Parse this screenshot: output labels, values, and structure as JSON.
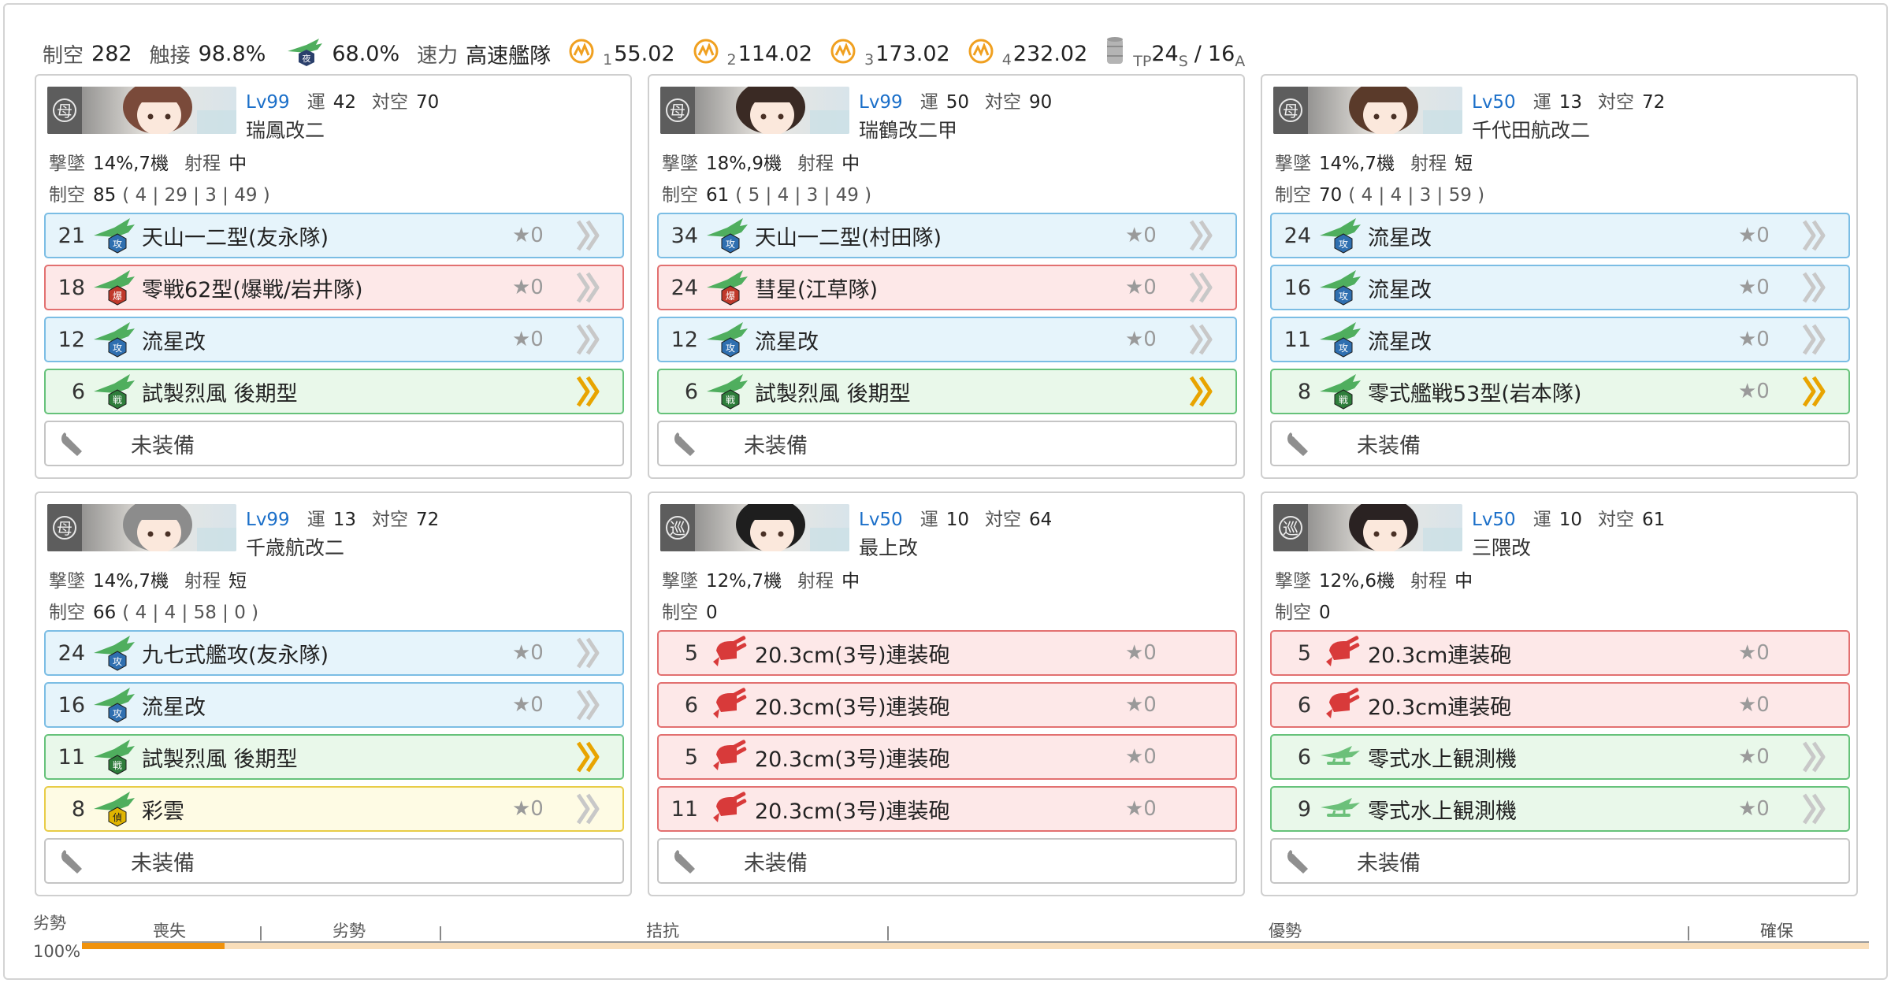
{
  "header": {
    "air_label": "制空",
    "air_value": "282",
    "contact_label": "触接",
    "contact_value": "98.8%",
    "recon_value": "68.0%",
    "speed_label": "速力",
    "speed_value": "高速艦隊",
    "los": [
      {
        "sub": "1",
        "value": "55.02"
      },
      {
        "sub": "2",
        "value": "114.02"
      },
      {
        "sub": "3",
        "value": "173.02"
      },
      {
        "sub": "4",
        "value": "232.02"
      }
    ],
    "tp_sub": "TP",
    "tp_s_value": "24",
    "tp_s_sub": "S",
    "tp_sep": "/",
    "tp_a_value": "16",
    "tp_a_sub": "A"
  },
  "labels": {
    "luck": "運",
    "aa": "対空",
    "shootdown": "撃墜",
    "range": "射程",
    "air": "制空",
    "empty_slot": "未装備"
  },
  "colors": {
    "blue_slot": "#e6f4fb",
    "red_slot": "#fde8e8",
    "green_slot": "#e9f8ea",
    "yellow_slot": "#fefbe4",
    "level_text": "#1b6fc9",
    "bar_fill": "#f0920c"
  },
  "ships": [
    {
      "level": "Lv99",
      "luck": "42",
      "aa": "70",
      "name": "瑞鳳改二",
      "shootdown": "14%,7機",
      "range": "中",
      "air": "85",
      "air_breakdown": "( 4 | 29 | 3 | 49 )",
      "badge": "母",
      "slots": [
        {
          "count": "21",
          "icon": "torpedo-bomber-icon",
          "name": "天山一二型(友永隊)",
          "star": "★0",
          "color": "blue",
          "prof": "gray"
        },
        {
          "count": "18",
          "icon": "dive-bomber-icon",
          "name": "零戦62型(爆戦/岩井隊)",
          "star": "★0",
          "color": "red",
          "prof": "gray"
        },
        {
          "count": "12",
          "icon": "torpedo-bomber-icon",
          "name": "流星改",
          "star": "★0",
          "color": "blue",
          "prof": "gray"
        },
        {
          "count": "6",
          "icon": "fighter-icon",
          "name": "試製烈風 後期型",
          "star": "",
          "color": "green",
          "prof": "gold"
        },
        {
          "count": "",
          "icon": "wrench-icon",
          "name": "未装備",
          "star": "",
          "color": "empty",
          "prof": "none"
        }
      ]
    },
    {
      "level": "Lv99",
      "luck": "50",
      "aa": "90",
      "name": "瑞鶴改二甲",
      "shootdown": "18%,9機",
      "range": "中",
      "air": "61",
      "air_breakdown": "( 5 | 4 | 3 | 49 )",
      "badge": "母",
      "slots": [
        {
          "count": "34",
          "icon": "torpedo-bomber-icon",
          "name": "天山一二型(村田隊)",
          "star": "★0",
          "color": "blue",
          "prof": "gray"
        },
        {
          "count": "24",
          "icon": "dive-bomber-icon",
          "name": "彗星(江草隊)",
          "star": "★0",
          "color": "red",
          "prof": "gray"
        },
        {
          "count": "12",
          "icon": "torpedo-bomber-icon",
          "name": "流星改",
          "star": "★0",
          "color": "blue",
          "prof": "gray"
        },
        {
          "count": "6",
          "icon": "fighter-icon",
          "name": "試製烈風 後期型",
          "star": "",
          "color": "green",
          "prof": "gold"
        },
        {
          "count": "",
          "icon": "wrench-icon",
          "name": "未装備",
          "star": "",
          "color": "empty",
          "prof": "none"
        }
      ]
    },
    {
      "level": "Lv50",
      "luck": "13",
      "aa": "72",
      "name": "千代田航改二",
      "shootdown": "14%,7機",
      "range": "短",
      "air": "70",
      "air_breakdown": "( 4 | 4 | 3 | 59 )",
      "badge": "母",
      "slots": [
        {
          "count": "24",
          "icon": "torpedo-bomber-icon",
          "name": "流星改",
          "star": "★0",
          "color": "blue",
          "prof": "gray"
        },
        {
          "count": "16",
          "icon": "torpedo-bomber-icon",
          "name": "流星改",
          "star": "★0",
          "color": "blue",
          "prof": "gray"
        },
        {
          "count": "11",
          "icon": "torpedo-bomber-icon",
          "name": "流星改",
          "star": "★0",
          "color": "blue",
          "prof": "gray"
        },
        {
          "count": "8",
          "icon": "fighter-icon",
          "name": "零式艦戦53型(岩本隊)",
          "star": "★0",
          "color": "green",
          "prof": "gold"
        },
        {
          "count": "",
          "icon": "wrench-icon",
          "name": "未装備",
          "star": "",
          "color": "empty",
          "prof": "none"
        }
      ]
    },
    {
      "level": "Lv99",
      "luck": "13",
      "aa": "72",
      "name": "千歳航改二",
      "shootdown": "14%,7機",
      "range": "短",
      "air": "66",
      "air_breakdown": "( 4 | 4 | 58 | 0 )",
      "badge": "母",
      "slots": [
        {
          "count": "24",
          "icon": "torpedo-bomber-icon",
          "name": "九七式艦攻(友永隊)",
          "star": "★0",
          "color": "blue",
          "prof": "gray"
        },
        {
          "count": "16",
          "icon": "torpedo-bomber-icon",
          "name": "流星改",
          "star": "★0",
          "color": "blue",
          "prof": "gray"
        },
        {
          "count": "11",
          "icon": "fighter-icon",
          "name": "試製烈風 後期型",
          "star": "",
          "color": "green",
          "prof": "gold"
        },
        {
          "count": "8",
          "icon": "recon-plane-icon",
          "name": "彩雲",
          "star": "★0",
          "color": "yellow",
          "prof": "gray"
        },
        {
          "count": "",
          "icon": "wrench-icon",
          "name": "未装備",
          "star": "",
          "color": "empty",
          "prof": "none"
        }
      ]
    },
    {
      "level": "Lv50",
      "luck": "10",
      "aa": "64",
      "name": "最上改",
      "shootdown": "12%,7機",
      "range": "中",
      "air": "0",
      "air_breakdown": "",
      "badge": "巡",
      "slots": [
        {
          "count": "5",
          "icon": "main-gun-icon",
          "name": "20.3cm(3号)連装砲",
          "star": "★0",
          "color": "red",
          "prof": "none"
        },
        {
          "count": "6",
          "icon": "main-gun-icon",
          "name": "20.3cm(3号)連装砲",
          "star": "★0",
          "color": "red",
          "prof": "none"
        },
        {
          "count": "5",
          "icon": "main-gun-icon",
          "name": "20.3cm(3号)連装砲",
          "star": "★0",
          "color": "red",
          "prof": "none"
        },
        {
          "count": "11",
          "icon": "main-gun-icon",
          "name": "20.3cm(3号)連装砲",
          "star": "★0",
          "color": "red",
          "prof": "none"
        },
        {
          "count": "",
          "icon": "wrench-icon",
          "name": "未装備",
          "star": "",
          "color": "empty",
          "prof": "none"
        }
      ]
    },
    {
      "level": "Lv50",
      "luck": "10",
      "aa": "61",
      "name": "三隈改",
      "shootdown": "12%,6機",
      "range": "中",
      "air": "0",
      "air_breakdown": "",
      "badge": "巡",
      "slots": [
        {
          "count": "5",
          "icon": "main-gun-icon",
          "name": "20.3cm連装砲",
          "star": "★0",
          "color": "red",
          "prof": "none"
        },
        {
          "count": "6",
          "icon": "main-gun-icon",
          "name": "20.3cm連装砲",
          "star": "★0",
          "color": "red",
          "prof": "none"
        },
        {
          "count": "6",
          "icon": "seaplane-icon",
          "name": "零式水上観測機",
          "star": "★0",
          "color": "green",
          "prof": "gray"
        },
        {
          "count": "9",
          "icon": "seaplane-icon",
          "name": "零式水上観測機",
          "star": "★0",
          "color": "green",
          "prof": "gray"
        },
        {
          "count": "",
          "icon": "wrench-icon",
          "name": "未装備",
          "star": "",
          "color": "empty",
          "prof": "none"
        }
      ]
    }
  ],
  "air_state": {
    "current_label": "劣勢",
    "current_pct": "100%",
    "fill_fraction": 0.08,
    "segments": [
      "喪失",
      "劣勢",
      "拮抗",
      "優勢",
      "確保"
    ]
  }
}
